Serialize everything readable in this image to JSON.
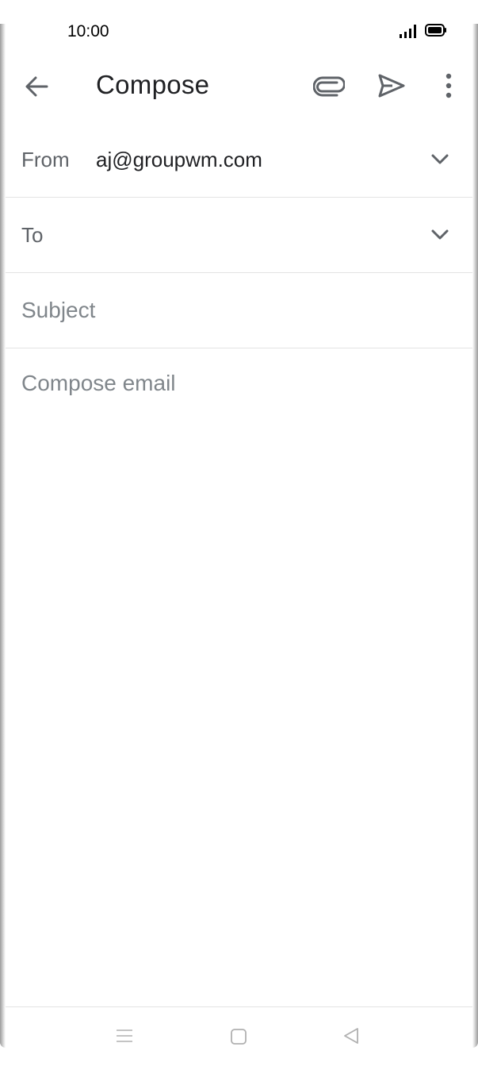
{
  "status_bar": {
    "time": "10:00",
    "icons": [
      "signal-icon",
      "battery-icon"
    ]
  },
  "app_bar": {
    "title": "Compose",
    "icons": [
      "back-arrow-icon",
      "attachment-icon",
      "send-icon",
      "more-vert-icon"
    ]
  },
  "from": {
    "label": "From",
    "value": "aj@groupwm.com"
  },
  "to": {
    "label": "To",
    "value": ""
  },
  "subject": {
    "placeholder": "Subject"
  },
  "body": {
    "placeholder": "Compose email"
  },
  "nav_bar": {
    "icons": [
      "menu-icon",
      "home-icon",
      "back-triangle-icon"
    ]
  },
  "colors": {
    "text_primary": "#202124",
    "text_secondary": "#5f6368",
    "placeholder": "#80868b",
    "divider": "#e3e3e3"
  }
}
